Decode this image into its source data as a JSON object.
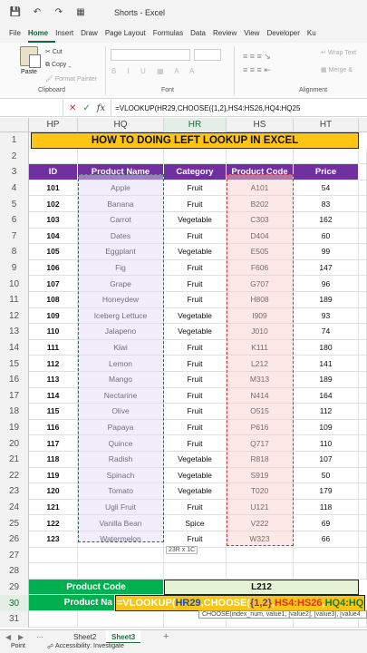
{
  "app": {
    "title": "Shorts - Excel"
  },
  "ribbon_tabs": [
    "File",
    "Home",
    "Insert",
    "Draw",
    "Page Layout",
    "Formulas",
    "Data",
    "Review",
    "View",
    "Developer",
    "Ku"
  ],
  "ribbon": {
    "paste": "Paste",
    "cut": "Cut",
    "copy": "Copy",
    "format_painter": "Format Painter",
    "clipboard": "Clipboard",
    "font": "Font",
    "alignment": "Alignment",
    "wrap_text": "Wrap Text",
    "merge": "Merge &"
  },
  "formula_bar": {
    "formula": "=VLOOKUP(HR29,CHOOSE({1,2},HS4:HS26,HQ4:HQ25"
  },
  "columns": [
    "HP",
    "HQ",
    "HR",
    "HS",
    "HT"
  ],
  "title": "HOW TO DOING LEFT LOOKUP IN EXCEL",
  "headers": [
    "ID",
    "Product Name",
    "Category",
    "Product Code",
    "Price"
  ],
  "rows": [
    [
      "101",
      "Apple",
      "Fruit",
      "A101",
      "54"
    ],
    [
      "102",
      "Banana",
      "Fruit",
      "B202",
      "83"
    ],
    [
      "103",
      "Carrot",
      "Vegetable",
      "C303",
      "162"
    ],
    [
      "104",
      "Dates",
      "Fruit",
      "D404",
      "60"
    ],
    [
      "105",
      "Eggplant",
      "Vegetable",
      "E505",
      "99"
    ],
    [
      "106",
      "Fig",
      "Fruit",
      "F606",
      "147"
    ],
    [
      "107",
      "Grape",
      "Fruit",
      "G707",
      "96"
    ],
    [
      "108",
      "Honeydew",
      "Fruit",
      "H808",
      "189"
    ],
    [
      "109",
      "Iceberg Lettuce",
      "Vegetable",
      "I909",
      "93"
    ],
    [
      "110",
      "Jalapeno",
      "Vegetable",
      "J010",
      "74"
    ],
    [
      "111",
      "Kiwi",
      "Fruit",
      "K111",
      "180"
    ],
    [
      "112",
      "Lemon",
      "Fruit",
      "L212",
      "141"
    ],
    [
      "113",
      "Mango",
      "Fruit",
      "M313",
      "189"
    ],
    [
      "114",
      "Nectarine",
      "Fruit",
      "N414",
      "164"
    ],
    [
      "115",
      "Olive",
      "Fruit",
      "O515",
      "112"
    ],
    [
      "116",
      "Papaya",
      "Fruit",
      "P616",
      "109"
    ],
    [
      "117",
      "Quince",
      "Fruit",
      "Q717",
      "110"
    ],
    [
      "118",
      "Radish",
      "Vegetable",
      "R818",
      "107"
    ],
    [
      "119",
      "Spinach",
      "Vegetable",
      "S919",
      "50"
    ],
    [
      "120",
      "Tomato",
      "Vegetable",
      "T020",
      "179"
    ],
    [
      "121",
      "Ugli Fruit",
      "Fruit",
      "U121",
      "118"
    ],
    [
      "122",
      "Vanilla Bean",
      "Spice",
      "V222",
      "69"
    ],
    [
      "123",
      "Watermelon",
      "Fruit",
      "W323",
      "66"
    ]
  ],
  "selection_size": "23R x 1C",
  "lookup": {
    "code_label": "Product Code",
    "code_value": "L212",
    "name_label": "Product Na",
    "formula_parts": {
      "p1": "=VLOOKUP(",
      "p2": "HR29",
      "p3": ",CHOOSE(",
      "p4": "{1,2}",
      "p5": ",",
      "p6": "HS4:HS26",
      "p7": ",",
      "p8": "HQ4:HQ2"
    },
    "hint": "CHOOSE(index_num, value1, [value2], [value3], [value4"
  },
  "sheets": [
    "Sheet2",
    "Sheet3"
  ],
  "status": {
    "mode": "Point",
    "accessibility": "Accessibility: Investigate"
  }
}
